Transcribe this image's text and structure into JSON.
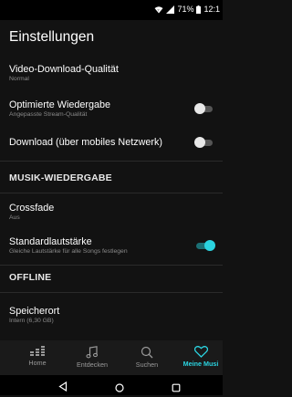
{
  "status_bar": {
    "battery_percent": "71%",
    "time": "12:1"
  },
  "page_title": "Einstellungen",
  "settings": [
    {
      "label": "Video-Download-Qualität",
      "sub": "Normal",
      "toggle": null
    },
    {
      "label": "Optimierte Wiedergabe",
      "sub": "Angepasste Stream-Qualität",
      "toggle": false
    },
    {
      "label": "Download (über mobiles Netzwerk)",
      "sub": "",
      "toggle": false
    }
  ],
  "section_musik": "MUSIK-WIEDERGABE",
  "musik_settings": [
    {
      "label": "Crossfade",
      "sub": "Aus",
      "toggle": null
    },
    {
      "label": "Standardlautstärke",
      "sub": "Gleiche Lautstärke für alle Songs festlegen",
      "toggle": true
    }
  ],
  "section_offline": "OFFLINE",
  "offline_settings": [
    {
      "label": "Speicherort",
      "sub": "Intern (6,30 GB)"
    }
  ],
  "bottom_nav": [
    {
      "label": "Home",
      "icon": "deezer-logo-icon",
      "active": false
    },
    {
      "label": "Entdecken",
      "icon": "music-note-icon",
      "active": false
    },
    {
      "label": "Suchen",
      "icon": "search-icon",
      "active": false
    },
    {
      "label": "Meine Musi",
      "icon": "heart-icon",
      "active": true
    }
  ],
  "colors": {
    "accent": "#2bd3e0",
    "background": "#121212"
  }
}
